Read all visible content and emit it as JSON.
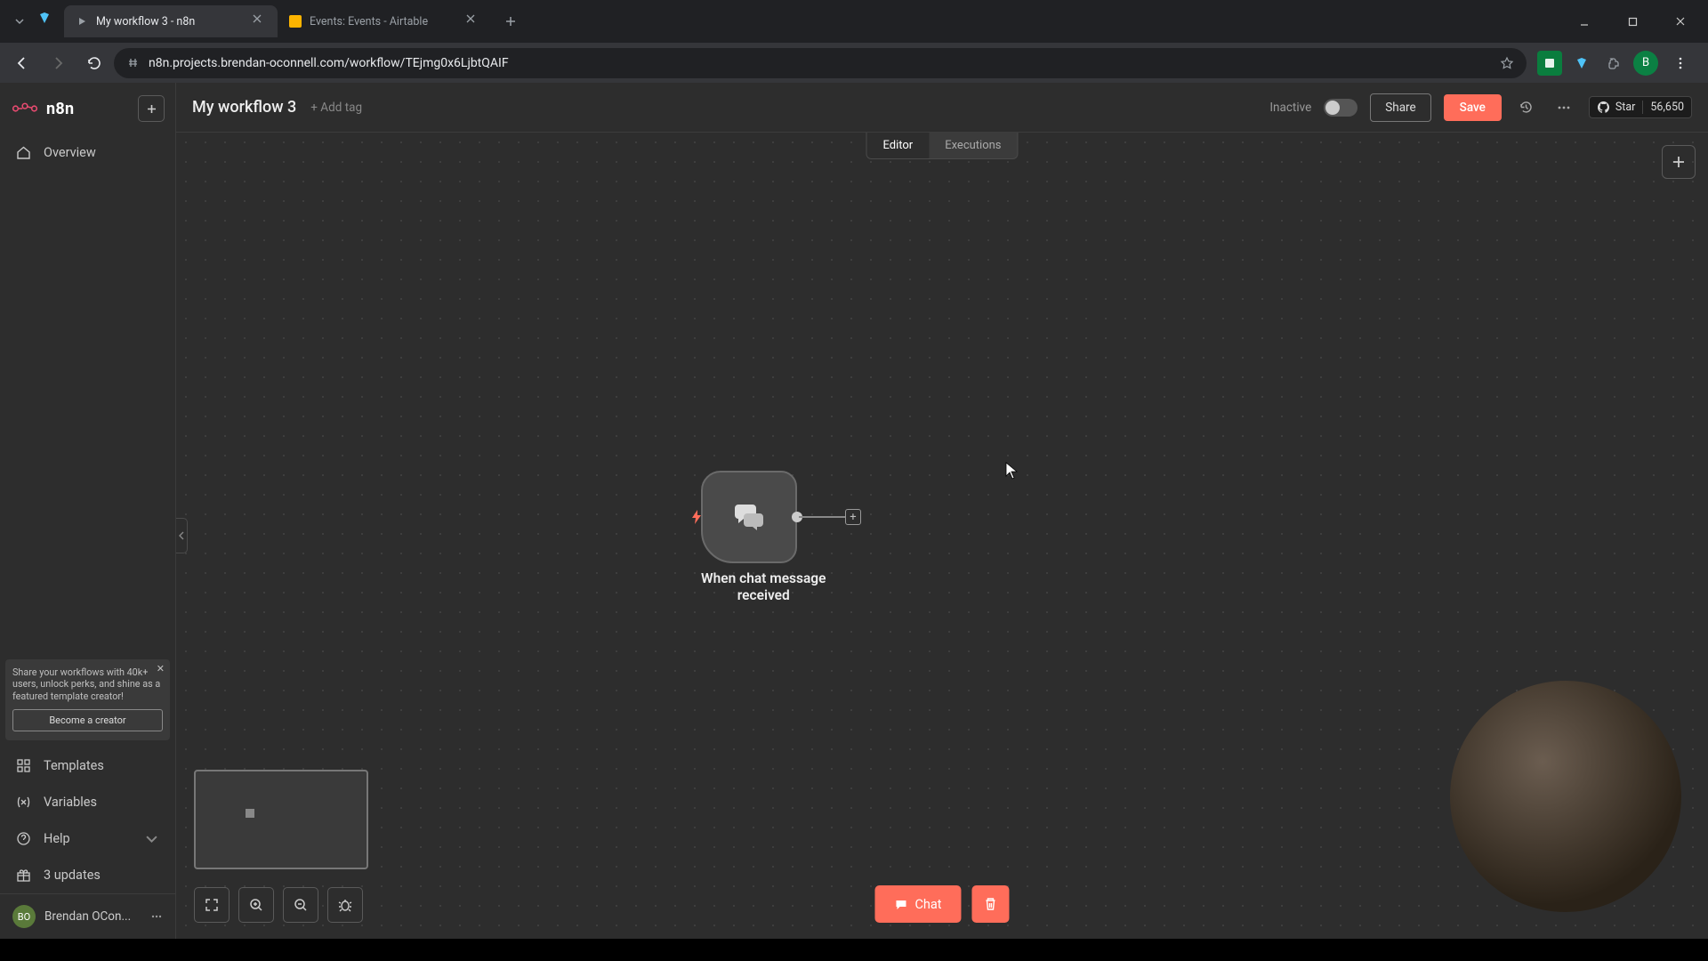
{
  "browser": {
    "tabs": [
      {
        "title": "My workflow 3 - n8n",
        "active": true
      },
      {
        "title": "Events: Events - Airtable",
        "active": false
      }
    ],
    "url": "n8n.projects.brendan-oconnell.com/workflow/TEjmg0x6LjbtQAIF",
    "profile_initial": "B"
  },
  "app": {
    "logo_text": "n8n",
    "sidebar": {
      "overview": "Overview",
      "templates": "Templates",
      "variables": "Variables",
      "help": "Help",
      "updates": "3 updates"
    },
    "creator": {
      "text": "Share your workflows with 40k+ users, unlock perks, and shine as a featured template creator!",
      "button": "Become a creator"
    },
    "user": {
      "name": "Brendan OCon...",
      "initials": "BO"
    }
  },
  "topbar": {
    "workflow_name": "My workflow 3",
    "add_tag": "+ Add tag",
    "status": "Inactive",
    "share": "Share",
    "save": "Save",
    "star_label": "Star",
    "star_count": "56,650"
  },
  "canvas": {
    "tabs": {
      "editor": "Editor",
      "executions": "Executions"
    },
    "node_label_l1": "When chat message",
    "node_label_l2": "received",
    "chat_button": "Chat"
  }
}
